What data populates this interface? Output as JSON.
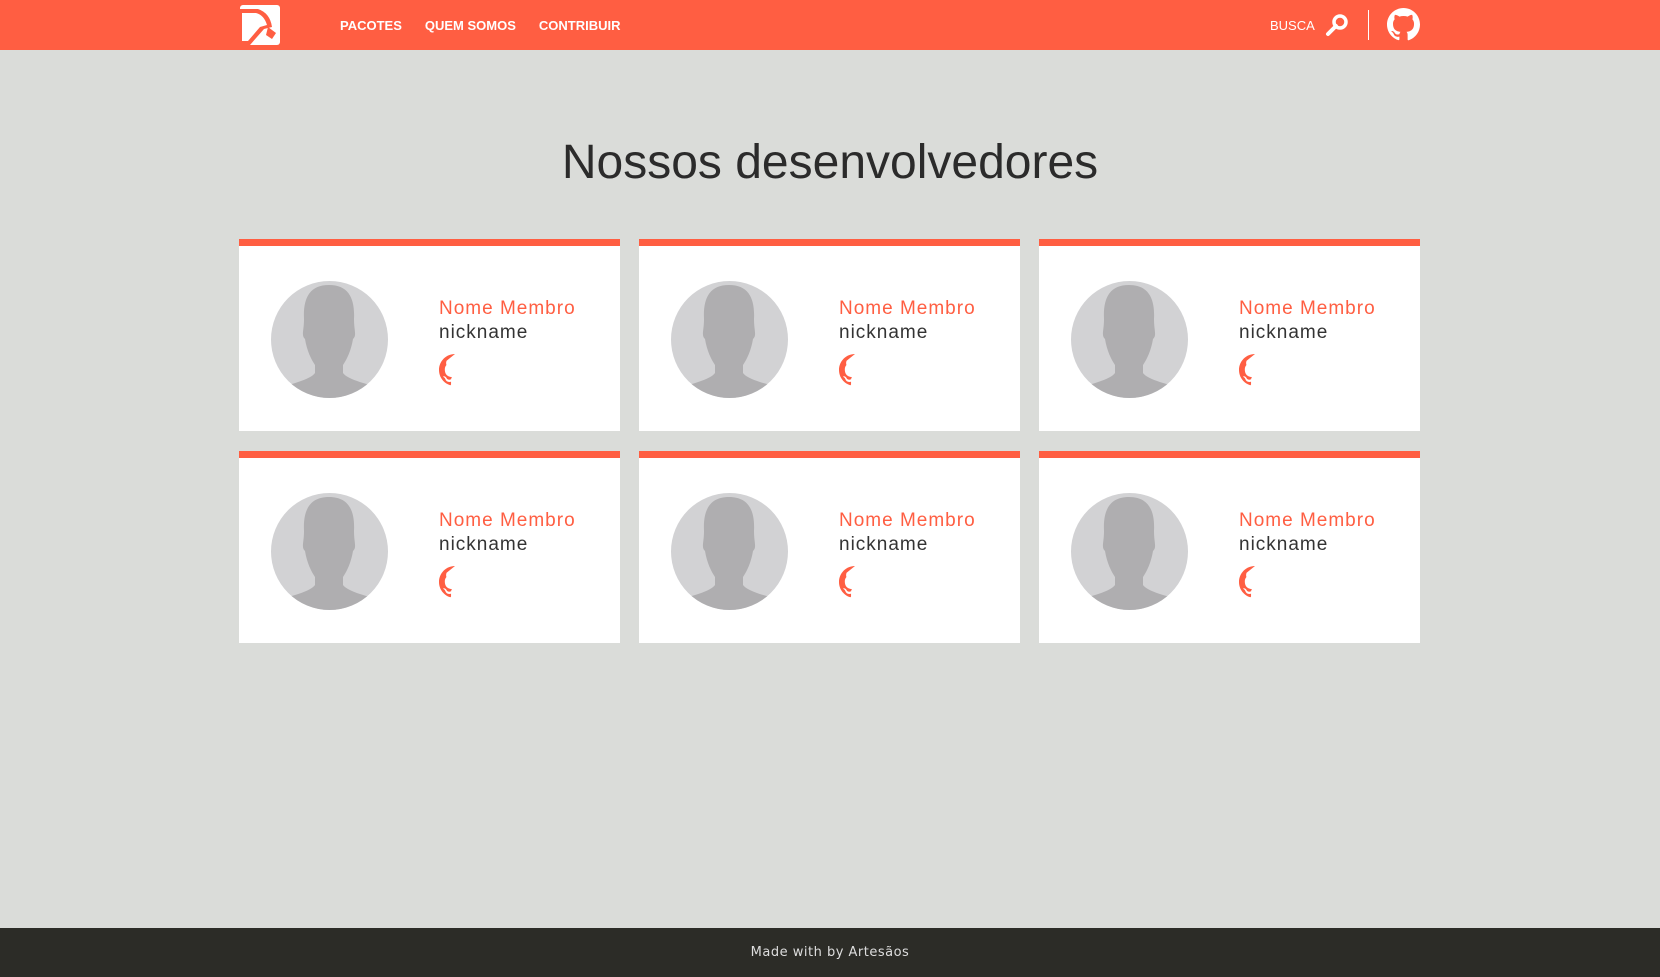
{
  "header": {
    "nav": [
      "PACOTES",
      "QUEM SOMOS",
      "CONTRIBUIR"
    ],
    "search_label": "BUSCA"
  },
  "page": {
    "title": "Nossos desenvolvedores"
  },
  "members": [
    {
      "name": "Nome Membro",
      "nickname": "nickname"
    },
    {
      "name": "Nome Membro",
      "nickname": "nickname"
    },
    {
      "name": "Nome Membro",
      "nickname": "nickname"
    },
    {
      "name": "Nome Membro",
      "nickname": "nickname"
    },
    {
      "name": "Nome Membro",
      "nickname": "nickname"
    },
    {
      "name": "Nome Membro",
      "nickname": "nickname"
    }
  ],
  "footer": {
    "text": "Made with by Artesãos"
  },
  "colors": {
    "accent": "#ff5e42",
    "background": "#dadcd9",
    "footer": "#2c2c27"
  }
}
